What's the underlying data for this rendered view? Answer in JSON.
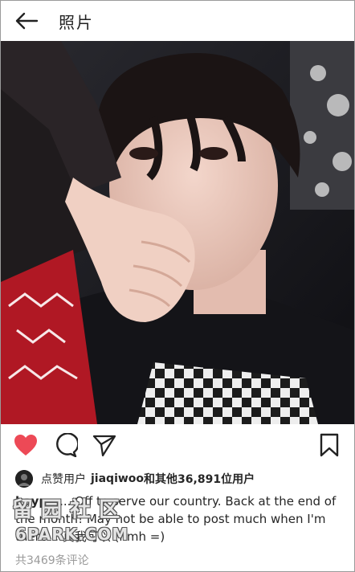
{
  "header": {
    "title": "照片",
    "back_icon": "back-arrow-icon"
  },
  "photo": {
    "description_icon": "photo"
  },
  "actions": {
    "like_icon": "heart-icon",
    "comment_icon": "comment-icon",
    "share_icon": "send-icon",
    "save_icon": "bookmark-icon",
    "like_color": "#ed4956"
  },
  "likes": {
    "prefix": "点赞用户",
    "user": "jiaqiwoo",
    "joiner": "和",
    "others": "其他36,891位用户"
  },
  "caption": {
    "user": "kaypa",
    "text": "... Off to serve our country. Back at the end of the month! May not be able to post much when I'm there... 真我可以 (hmh =)"
  },
  "comments": {
    "text": "共3469条评论"
  },
  "watermark": {
    "line1": "留园社区",
    "line2": "6PARK.COM"
  }
}
